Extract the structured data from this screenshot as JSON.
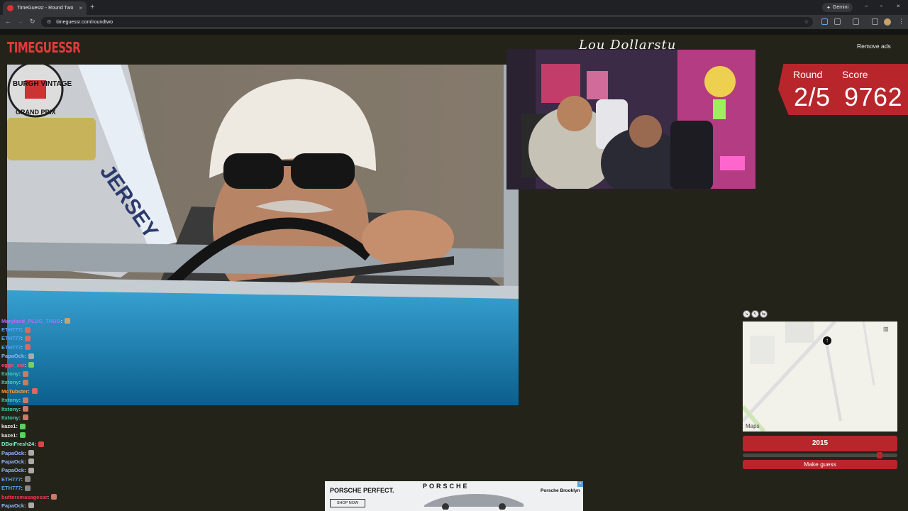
{
  "browser": {
    "tab_title": "TimeGuessr - Round Two",
    "new_tab": "+",
    "tab_close": "×",
    "gemini_label": "Gemini",
    "url": "timeguessr.com/roundtwo",
    "window_controls": [
      "–",
      "▫",
      "×"
    ]
  },
  "header": {
    "logo_text": "TIMEGUESSR",
    "remove_ads": "Remove ads"
  },
  "game": {
    "round_label": "Round",
    "score_label": "Score",
    "round_value": "2/5",
    "score_value": "9762",
    "map_credit": "Maps",
    "year_value": "2015",
    "year_fraction": 0.9,
    "make_guess": "Make guess"
  },
  "webcam": {
    "signature": "Lou Dollarstu"
  },
  "chat": [
    {
      "user": "Maryland_PLUG_THUG",
      "color": "#b56cff",
      "emote": "#c9a36a"
    },
    {
      "user": "ETH777",
      "color": "#5aa7ff",
      "emote": "#d66"
    },
    {
      "user": "ETH777",
      "color": "#5aa7ff",
      "emote": "#d66"
    },
    {
      "user": "ETH777",
      "color": "#5aa7ff",
      "emote": "#d66"
    },
    {
      "user": "PapaOck",
      "color": "#8fb3ff",
      "emote": "#aaa"
    },
    {
      "user": "eggs_eat",
      "color": "#ff4d6d",
      "emote": "#7ad15a"
    },
    {
      "user": "Itxtony",
      "color": "#4ad1b0",
      "emote": "#c97a6a"
    },
    {
      "user": "Itxtony",
      "color": "#4ad1b0",
      "emote": "#c97a6a"
    },
    {
      "user": "McTubster",
      "color": "#ff9a3c",
      "emote": "#d66"
    },
    {
      "user": "Itxtony",
      "color": "#4ad1b0",
      "emote": "#c97a6a"
    },
    {
      "user": "Itxtony",
      "color": "#4ad1b0",
      "emote": "#c97a6a"
    },
    {
      "user": "Itxtony",
      "color": "#4ad1b0",
      "emote": "#c97a6a"
    },
    {
      "user": "kaze1",
      "color": "#e6e6e6",
      "emote": "#5ad15a"
    },
    {
      "user": "kaze1",
      "color": "#e6e6e6",
      "emote": "#5ad15a"
    },
    {
      "user": "DBoiFresh24",
      "color": "#7ff5c8",
      "emote": "#d44"
    },
    {
      "user": "PapaOck",
      "color": "#8fb3ff",
      "emote": "#aaa"
    },
    {
      "user": "PapaOck",
      "color": "#8fb3ff",
      "emote": "#aaa"
    },
    {
      "user": "PapaOck",
      "color": "#8fb3ff",
      "emote": "#aaa"
    },
    {
      "user": "ETH777",
      "color": "#5aa7ff",
      "emote": "#888"
    },
    {
      "user": "ETH777",
      "color": "#5aa7ff",
      "emote": "#888"
    },
    {
      "user": "buttersmasagesar",
      "color": "#ff3355",
      "emote": "#c97a6a"
    },
    {
      "user": "PapaOck",
      "color": "#8fb3ff",
      "emote": "#aaa"
    }
  ],
  "ad": {
    "headline": "PORSCHE PERFECT.",
    "brand": "PORSCHE",
    "location": "Porsche Brooklyn",
    "cta": "SHOP NOW"
  },
  "photo_overlay": {
    "banner_line1": "BURGH VINTAGE",
    "banner_line2": "GRAND PRIX",
    "sash_text": "JERSEY"
  },
  "colors": {
    "accent": "#b8262b",
    "page_bg": "#232319",
    "chrome_bg": "#202124"
  }
}
